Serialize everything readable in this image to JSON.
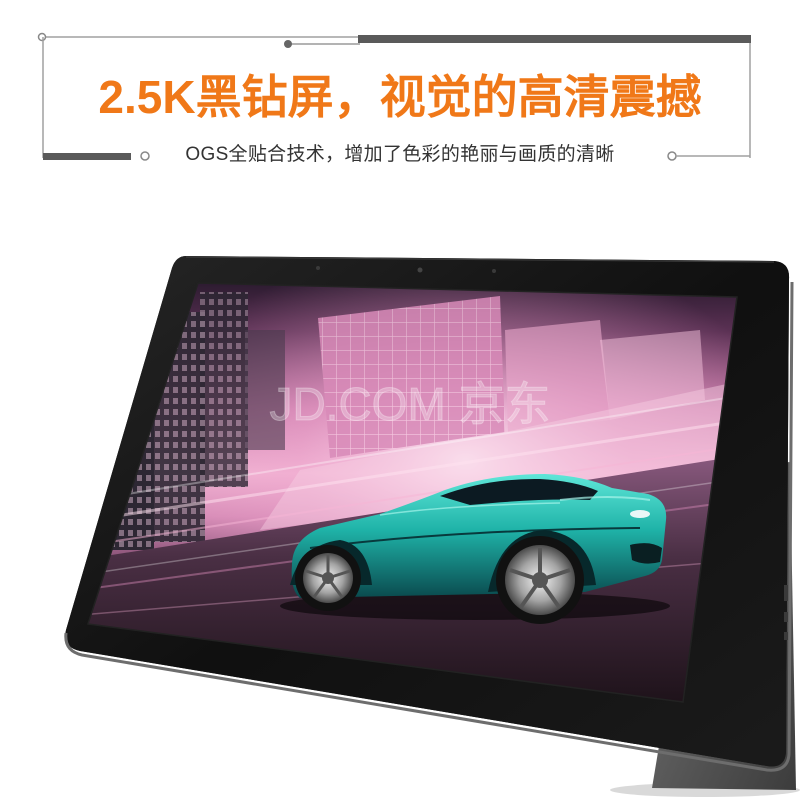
{
  "header": {
    "title": "2.5K黑钻屏，视觉的高清震撼",
    "subtitle": "OGS全贴合技术，增加了色彩的艳丽与画质的清晰"
  },
  "watermark": "JD.COM 京东",
  "colors": {
    "title": "#f07818",
    "subtitle": "#333333",
    "frame_line": "#a0a0a0",
    "frame_bar": "#5a5a5a",
    "tablet_bezel": "#0e0e0e",
    "car_body": "#1fb3a8"
  },
  "icons": [
    "frame-dot-icon",
    "camera-icon"
  ]
}
